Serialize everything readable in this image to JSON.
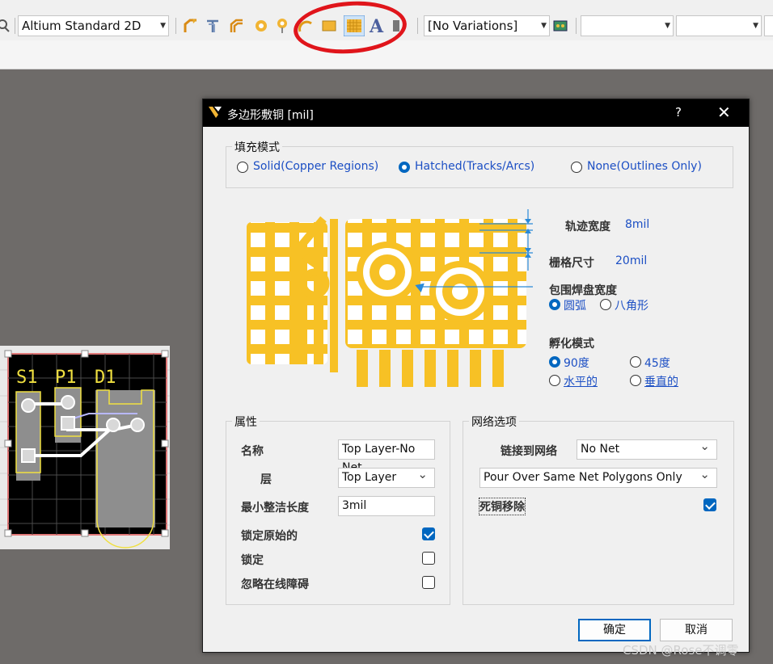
{
  "toolbar": {
    "view_combo": "Altium Standard 2D",
    "variations_combo": "[No Variations]",
    "icons": [
      "search-icon",
      "interactive-routing-icon",
      "diff-pair-routing-icon",
      "multi-routing-icon",
      "pad-icon",
      "via-icon",
      "arc-icon",
      "fill-icon",
      "polygon-pour-icon",
      "string-icon",
      "component-icon"
    ]
  },
  "pcb": {
    "labels": [
      "S1",
      "P1",
      "D1"
    ]
  },
  "dialog": {
    "title": "多边形敷铜 [mil]",
    "help": "?",
    "close": "✕",
    "fill_mode": {
      "title": "填充模式",
      "options": [
        "Solid(Copper Regions)",
        "Hatched(Tracks/Arcs)",
        "None(Outlines Only)"
      ],
      "selected": "Hatched(Tracks/Arcs)"
    },
    "params": {
      "track_width_label": "轨迹宽度",
      "track_width_value": "8mil",
      "grid_size_label": "栅格尺寸",
      "grid_size_value": "20mil",
      "surround_label": "包围焊盘宽度",
      "surround_options": [
        "圆弧",
        "八角形"
      ],
      "surround_selected": "圆弧",
      "hatch_label": "孵化模式",
      "hatch_options": [
        "90度",
        "45度",
        "水平的",
        "垂直的"
      ],
      "hatch_selected": "90度"
    },
    "properties": {
      "title": "属性",
      "name_label": "名称",
      "name_value": "Top Layer-No Net",
      "layer_label": "层",
      "layer_value": "Top Layer",
      "min_length_label": "最小整洁长度",
      "min_length_value": "3mil",
      "lock_primitives_label": "锁定原始的",
      "lock_primitives_checked": true,
      "locked_label": "锁定",
      "locked_checked": false,
      "ignore_obstacles_label": "忽略在线障碍",
      "ignore_obstacles_checked": false
    },
    "net": {
      "title": "网络选项",
      "connect_label": "链接到网络",
      "connect_value": "No Net",
      "pour_value": "Pour Over Same Net Polygons Only",
      "remove_dead_label": "死铜移除",
      "remove_dead_checked": true
    },
    "buttons": {
      "ok": "确定",
      "cancel": "取消"
    }
  },
  "watermark": "CSDN @Rose不调零",
  "colors": {
    "copper": "#f7c125",
    "accent": "#0067c0",
    "annotation": "#e0151b"
  }
}
